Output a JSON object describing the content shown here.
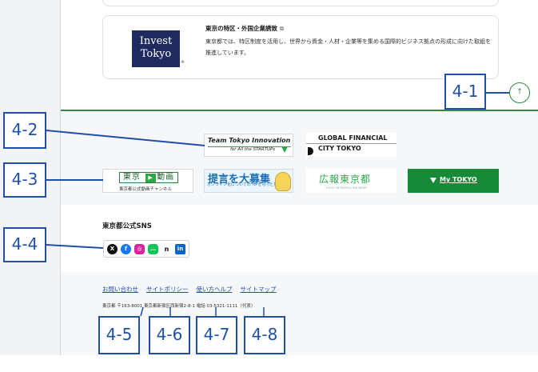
{
  "promo": {
    "logo_line1": "Invest",
    "logo_line2": "Tokyo",
    "logo_mark": "®",
    "title": "東京の特区・外国企業誘致",
    "external_icon": "external-link-icon",
    "description": "東京都では、特区制度を活用し、世界から資金・人材・企業等を集める国際的ビジネス拠点の形成に向けた取組を推進しています。"
  },
  "pagetop": {
    "icon": "arrow-up-icon",
    "glyph": "↑"
  },
  "banners": {
    "team_tokyo": {
      "line1": "Team Tokyo Innovation",
      "line2": "for All the STARTUPs"
    },
    "gfct": {
      "line1": "GLOBAL FINANCIAL",
      "line2": "CITY TOKYO"
    },
    "movie": {
      "title_left": "東京",
      "play": "▶",
      "title_right": "動画",
      "subtitle": "東京都公式動画チャンネル"
    },
    "teigen": {
      "title": "提言を大募集",
      "subtitle": "オンライン化についての HPをもっと見やすく"
    },
    "koho": {
      "title": "広報東京都",
      "subtitle": "TOKYO METROPOLITAN NEWS"
    },
    "mytokyo": {
      "label": "My TOKYO"
    }
  },
  "sns": {
    "heading": "東京都公式SNS",
    "icons": [
      {
        "name": "x-icon",
        "glyph": "X"
      },
      {
        "name": "facebook-icon",
        "glyph": "f"
      },
      {
        "name": "instagram-icon",
        "glyph": "◎"
      },
      {
        "name": "line-icon",
        "glyph": "…"
      },
      {
        "name": "note-icon",
        "glyph": "n"
      },
      {
        "name": "linkedin-icon",
        "glyph": "in"
      }
    ]
  },
  "footer": {
    "links": [
      "お問い合わせ",
      "サイトポリシー",
      "使い方ヘルプ",
      "サイトマップ"
    ],
    "address": "東京都 〒163-8001 東京都新宿区西新宿2-8-1 電話 03-5321-1111（代表）"
  },
  "callouts": [
    "4-1",
    "4-2",
    "4-3",
    "4-4",
    "4-5",
    "4-6",
    "4-7",
    "4-8"
  ],
  "colors": {
    "accent_green": "#2e8b3f",
    "callout_blue": "#1f4fa8",
    "mytokyo_green": "#178a38"
  }
}
